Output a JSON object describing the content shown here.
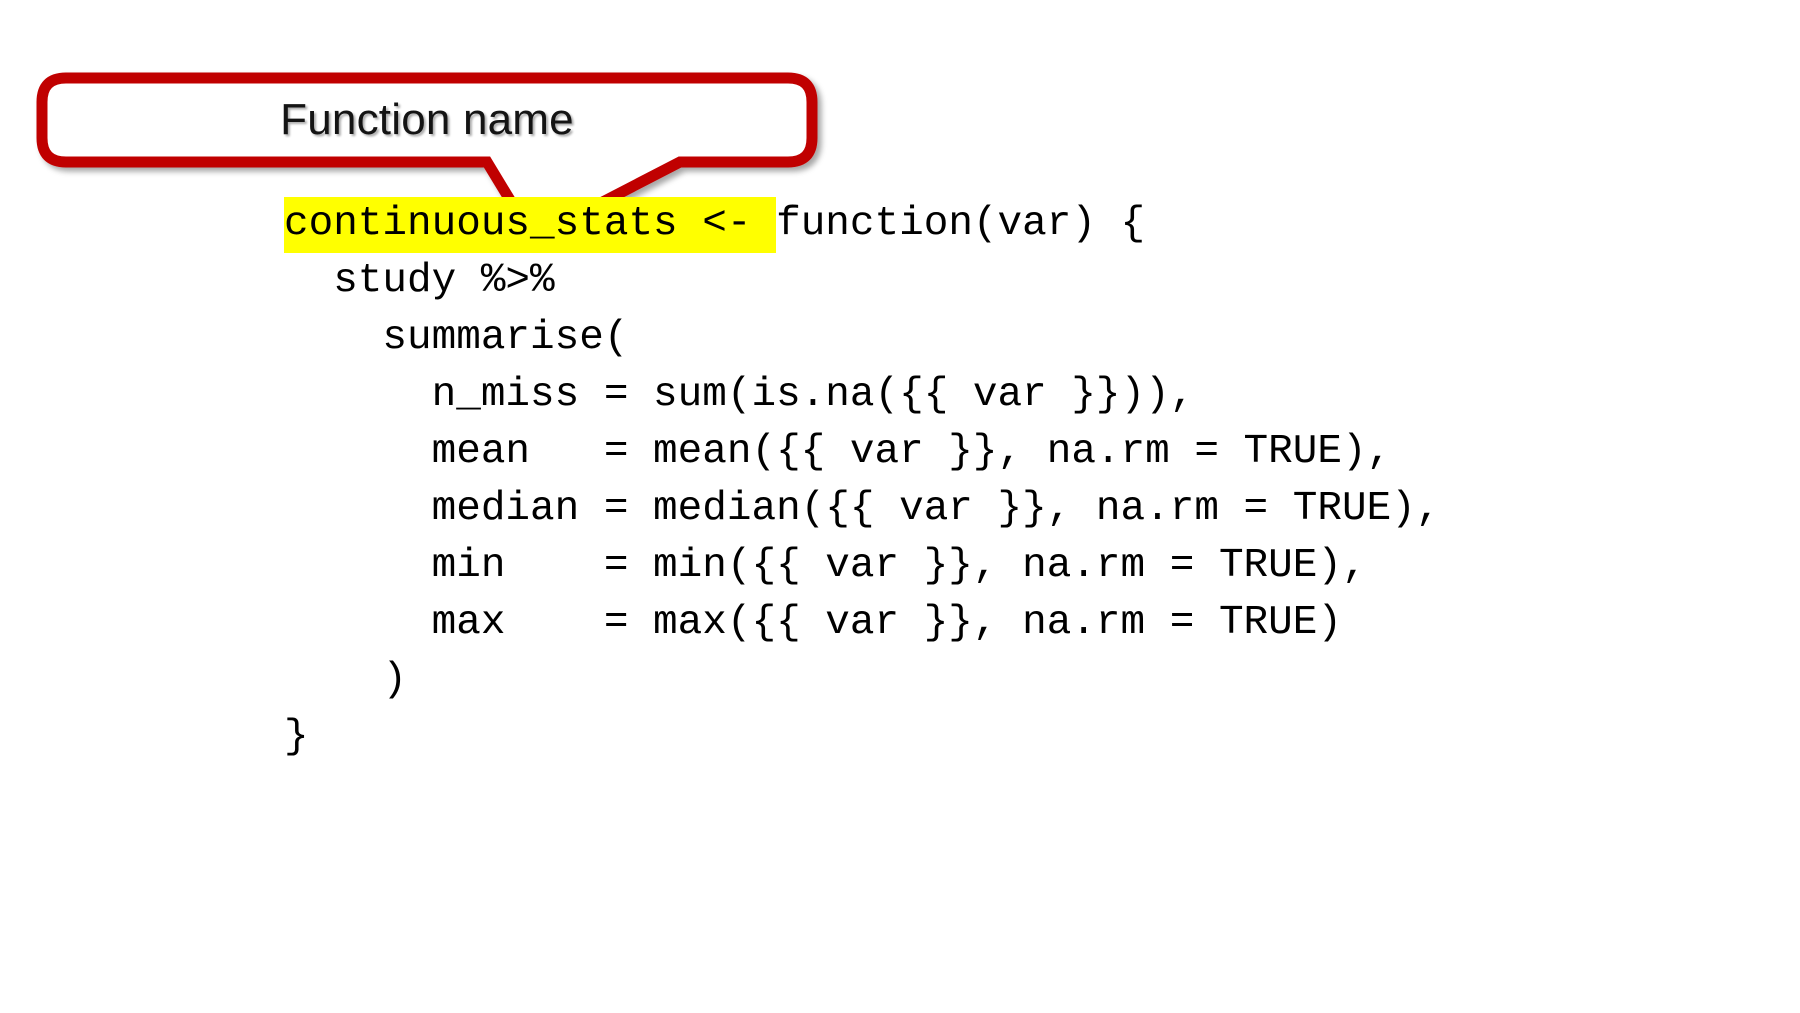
{
  "slide": {
    "background_color": "#ffffff",
    "callout": {
      "label": "Function name",
      "border_color": "#c00000",
      "fill_color": "#ffffff",
      "text_color": "#141414",
      "points_to": "continuous_stats"
    },
    "code": {
      "language": "R",
      "font": "monospace",
      "text_color": "#000000",
      "highlight_color": "#ffff00",
      "highlighted_text": "continuous_stats <- ",
      "lines": [
        {
          "indent": 0,
          "segments": [
            {
              "text": "continuous_stats <- ",
              "highlight": true
            },
            {
              "text": "function(var) {",
              "highlight": false
            }
          ]
        },
        {
          "indent": 0,
          "segments": [
            {
              "text": "  study %>%",
              "highlight": false
            }
          ]
        },
        {
          "indent": 0,
          "segments": [
            {
              "text": "    summarise(",
              "highlight": false
            }
          ]
        },
        {
          "indent": 0,
          "segments": [
            {
              "text": "      n_miss = sum(is.na({{ var }})),",
              "highlight": false
            }
          ]
        },
        {
          "indent": 0,
          "segments": [
            {
              "text": "      mean   = mean({{ var }}, na.rm = TRUE),",
              "highlight": false
            }
          ]
        },
        {
          "indent": 0,
          "segments": [
            {
              "text": "      median = median({{ var }}, na.rm = TRUE),",
              "highlight": false
            }
          ]
        },
        {
          "indent": 0,
          "segments": [
            {
              "text": "      min    = min({{ var }}, na.rm = TRUE),",
              "highlight": false
            }
          ]
        },
        {
          "indent": 0,
          "segments": [
            {
              "text": "      max    = max({{ var }}, na.rm = TRUE)",
              "highlight": false
            }
          ]
        },
        {
          "indent": 0,
          "segments": [
            {
              "text": "    )",
              "highlight": false
            }
          ]
        },
        {
          "indent": 0,
          "segments": [
            {
              "text": "}",
              "highlight": false
            }
          ]
        }
      ]
    }
  }
}
